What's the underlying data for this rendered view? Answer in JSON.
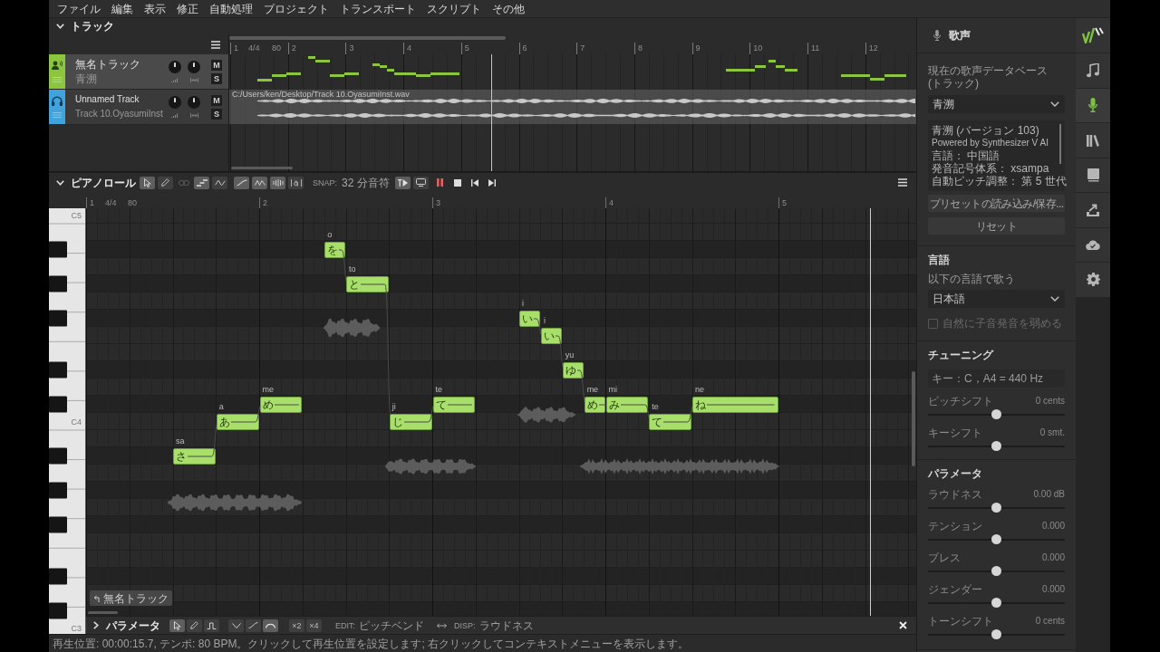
{
  "menu_bar": {
    "items": [
      "ファイル",
      "編集",
      "表示",
      "修正",
      "自動処理",
      "プロジェクト",
      "トランスポート",
      "スクリプト",
      "その他"
    ]
  },
  "track_panel": {
    "title": "トラック",
    "expanded": true,
    "ruler": {
      "time_signature": "4/4",
      "tempo": "80",
      "measures": [
        "1",
        "2",
        "3",
        "4",
        "5",
        "6",
        "7",
        "8",
        "9",
        "10",
        "11",
        "12"
      ]
    },
    "tracks": [
      {
        "kind": "voice",
        "name": "無名トラック",
        "subtitle": "青溯",
        "color": "#8cc63f",
        "selected": true,
        "buttons": [
          "M",
          "S"
        ]
      },
      {
        "kind": "audio",
        "name": "Unnamed Track",
        "subtitle": "Track 10.OyasumiInst",
        "color": "#41a3dc",
        "selected": false,
        "buttons": [
          "M",
          "S"
        ],
        "clip_label": "C:/Users/ken/Desktop/Track 10.OyasumiInst.wav"
      }
    ]
  },
  "piano_roll": {
    "title": "ピアノロール",
    "expanded": true,
    "edit_tools": [
      {
        "selected": true,
        "disabled": false
      },
      {
        "selected": false,
        "disabled": false
      },
      {
        "selected": false,
        "disabled": true
      },
      {
        "selected": true,
        "disabled": false
      },
      {
        "selected": false,
        "disabled": false
      }
    ],
    "curve_tools": [
      {
        "selected": true
      },
      {
        "selected": true
      },
      {
        "selected": true
      },
      {
        "selected": false
      }
    ],
    "snap_label": "SNAP:",
    "snap_value": "32 分音符",
    "playback_tools": [
      {
        "selected": true
      },
      {
        "selected": false
      }
    ],
    "ruler": {
      "time_signature": "4/4",
      "tempo": "80",
      "measures": [
        "1",
        "2",
        "3",
        "4",
        "5"
      ]
    },
    "key_labels": [
      "C5",
      "C4",
      "C3"
    ],
    "notes": [
      {
        "phoneme": "sa",
        "lyric": "さ"
      },
      {
        "phoneme": "a",
        "lyric": "あ"
      },
      {
        "phoneme": "me",
        "lyric": "め"
      },
      {
        "phoneme": "o",
        "lyric": "を"
      },
      {
        "phoneme": "to",
        "lyric": "と"
      },
      {
        "phoneme": "ji",
        "lyric": "じ"
      },
      {
        "phoneme": "te",
        "lyric": "て"
      },
      {
        "phoneme": "i",
        "lyric": "い"
      },
      {
        "phoneme": "i",
        "lyric": "い"
      },
      {
        "phoneme": "yu",
        "lyric": "ゆ"
      },
      {
        "phoneme": "me",
        "lyric": "め"
      },
      {
        "phoneme": "mi",
        "lyric": "み"
      },
      {
        "phoneme": "te",
        "lyric": "て"
      },
      {
        "phoneme": "ne",
        "lyric": "ね"
      }
    ],
    "back_button": "無名トラック"
  },
  "parameter_panel": {
    "title": "パラメータ",
    "expanded": false,
    "tools": [
      {
        "selected": true
      },
      {
        "selected": false
      },
      {
        "selected": false
      }
    ],
    "curve_tools": [
      {
        "selected": false
      },
      {
        "selected": false
      },
      {
        "selected": true
      }
    ],
    "multipliers": [
      "×2",
      "×4"
    ],
    "edit_label": "EDIT:",
    "edit_value": "ピッチベンド",
    "display_label": "DISP:",
    "display_value": "ラウドネス"
  },
  "status_bar": {
    "text": "再生位置: 00:00:15.7, テンポ: 80 BPM。クリックして再生位置を設定します; 右クリックしてコンテキストメニューを表示します。"
  },
  "side_panel": {
    "title": "歌声",
    "database": {
      "label": "現在の歌声データベース (トラック)",
      "value": "青溯",
      "info": [
        "青溯 (バージョン 103)",
        "Powered by Synthesizer V AI",
        "言語： 中国語",
        "発音記号体系： xsampa",
        "自動ピッチ調整： 第 5 世代"
      ]
    },
    "buttons": [
      "プリセットの読み込み/保存...",
      "リセット"
    ],
    "language": {
      "title": "言語",
      "label": "以下の言語で歌う",
      "value": "日本語",
      "option": {
        "label": "自然に子音発音を弱める",
        "checked": false,
        "disabled": true
      }
    },
    "tuning": {
      "title": "チューニング",
      "key": "キー：C，A4 = 440 Hz",
      "sliders": [
        {
          "label": "ピッチシフト",
          "reading": "0 cents",
          "level": 0.5
        },
        {
          "label": "キーシフト",
          "reading": "0 smt.",
          "level": 0.5
        }
      ]
    },
    "parameters": {
      "title": "パラメータ",
      "sliders": [
        {
          "label": "ラウドネス",
          "reading": "0.00 dB",
          "level": 0.5
        },
        {
          "label": "テンション",
          "reading": "0.000",
          "level": 0.5
        },
        {
          "label": "ブレス",
          "reading": "0.000",
          "level": 0.5
        },
        {
          "label": "ジェンダー",
          "reading": "0.000",
          "level": 0.5
        },
        {
          "label": "トーンシフト",
          "reading": "0 cents",
          "level": 0.5
        }
      ]
    }
  },
  "icon_bar": {
    "items": [
      {
        "selected": false
      },
      {
        "selected": true
      },
      {
        "selected": false
      },
      {
        "selected": false
      },
      {
        "selected": false
      },
      {
        "selected": false
      },
      {
        "selected": false
      }
    ]
  }
}
